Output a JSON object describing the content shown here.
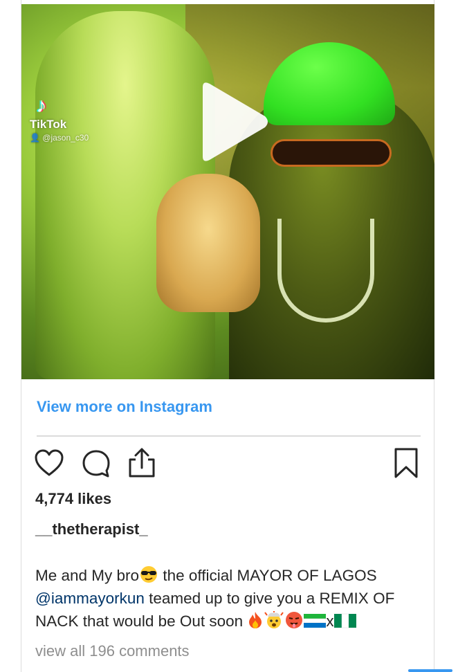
{
  "post": {
    "video_overlay": {
      "brand": "TikTok",
      "handle": "@jason_c30"
    },
    "view_more_label": "View more on Instagram",
    "likes_text": "4,774 likes",
    "username": "__thetherapist_",
    "caption": {
      "part1": "Me and My bro",
      "part2": " the official MAYOR OF LAGOS ",
      "mention": "@iammayorkun",
      "part3": " teamed up to give you a REMIX OF NACK that would be Out soon ",
      "between_flags": "x"
    },
    "comments_link": "view all 196 comments"
  },
  "icons": {
    "play": "play-icon",
    "like": "heart-icon",
    "comment": "comment-bubble-icon",
    "share": "share-icon",
    "save": "bookmark-icon"
  },
  "colors": {
    "link_blue": "#3897f0",
    "mention_blue": "#003569",
    "muted": "#8e8e8e",
    "text": "#262626"
  }
}
